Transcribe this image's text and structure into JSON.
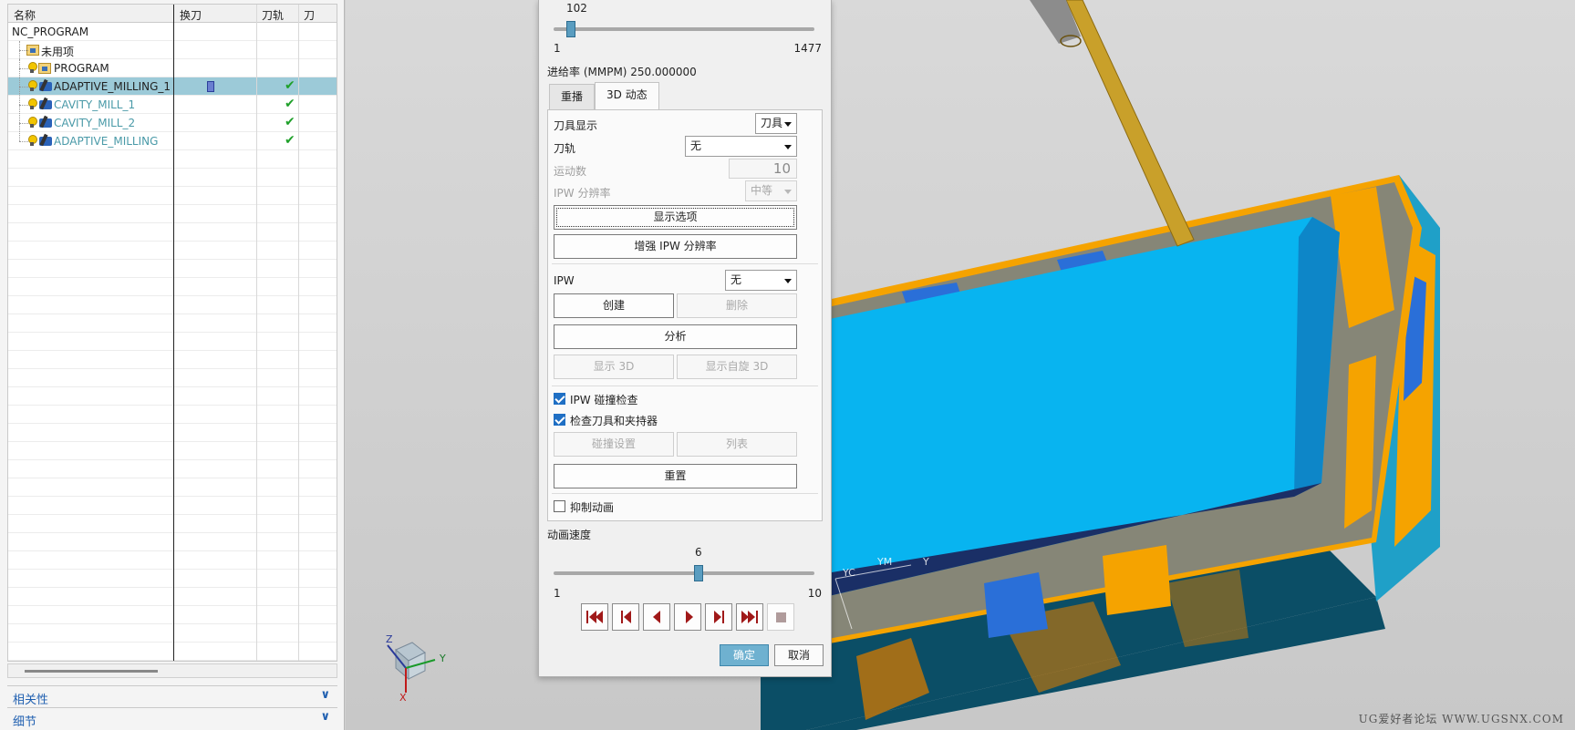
{
  "navigator": {
    "columns": [
      "名称",
      "换刀",
      "刀轨",
      "刀"
    ],
    "rows": [
      {
        "name": "NC_PROGRAM",
        "type": "root"
      },
      {
        "name": "未用项",
        "type": "group"
      },
      {
        "name": "PROGRAM",
        "type": "program"
      },
      {
        "name": "ADAPTIVE_MILLING_1",
        "type": "operation",
        "selected": true,
        "status_text": "D"
      },
      {
        "name": "CAVITY_MILL_1",
        "type": "operation",
        "status_text": "D"
      },
      {
        "name": "CAVITY_MILL_2",
        "type": "operation",
        "status_text": "D"
      },
      {
        "name": "ADAPTIVE_MILLING",
        "type": "operation",
        "status_text": "D"
      }
    ],
    "sections": [
      "相关性",
      "细节"
    ]
  },
  "dialog": {
    "position_slider": {
      "value": "102",
      "min": "1",
      "max": "1477",
      "fraction": 0.067
    },
    "feed_rate": "进给率 (MMPM) 250.000000",
    "tabs": [
      "重播",
      "3D 动态"
    ],
    "active_tab": "3D 动态",
    "tool_display": {
      "label": "刀具显示",
      "value": "刀具"
    },
    "toolpath": {
      "label": "刀轨",
      "value": "无"
    },
    "motion_count": {
      "label": "运动数",
      "value": "10"
    },
    "ipw_resolution": {
      "label": "IPW 分辨率",
      "value": "中等"
    },
    "display_options_button": "显示选项",
    "enhance_ipw_button": "增强 IPW 分辨率",
    "ipw": {
      "label": "IPW",
      "value": "无"
    },
    "create_button": "创建",
    "delete_button": "删除",
    "analyze_button": "分析",
    "show_3d_button": "显示 3D",
    "show_spin_3d_button": "显示自旋 3D",
    "ipw_collision_check": {
      "label": "IPW 碰撞检查",
      "checked": true
    },
    "check_tool_holder": {
      "label": "检查刀具和夹持器",
      "checked": true
    },
    "collision_settings_button": "碰撞设置",
    "list_button": "列表",
    "reset_button": "重置",
    "suppress_animation": {
      "label": "抑制动画",
      "checked": false
    },
    "speed_label": "动画速度",
    "speed_slider": {
      "value": "6",
      "min": "1",
      "max": "10",
      "fraction": 0.556
    },
    "ok_button": "确定",
    "cancel_button": "取消"
  },
  "viewport": {
    "triad": {
      "z": "Z",
      "y": "Y",
      "x": "X"
    },
    "wcs": {
      "yc": "YC",
      "ym": "YM",
      "y": "Y"
    },
    "watermark": "UG爱好者论坛 WWW.UGSNX.COM",
    "colors": {
      "part_top": "#08b4f0",
      "stock_remaining": "#f5a300",
      "side_blue": "#2a6fd8",
      "dark_teal": "#0b4e66",
      "tool_shank": "#c9a02a"
    }
  }
}
